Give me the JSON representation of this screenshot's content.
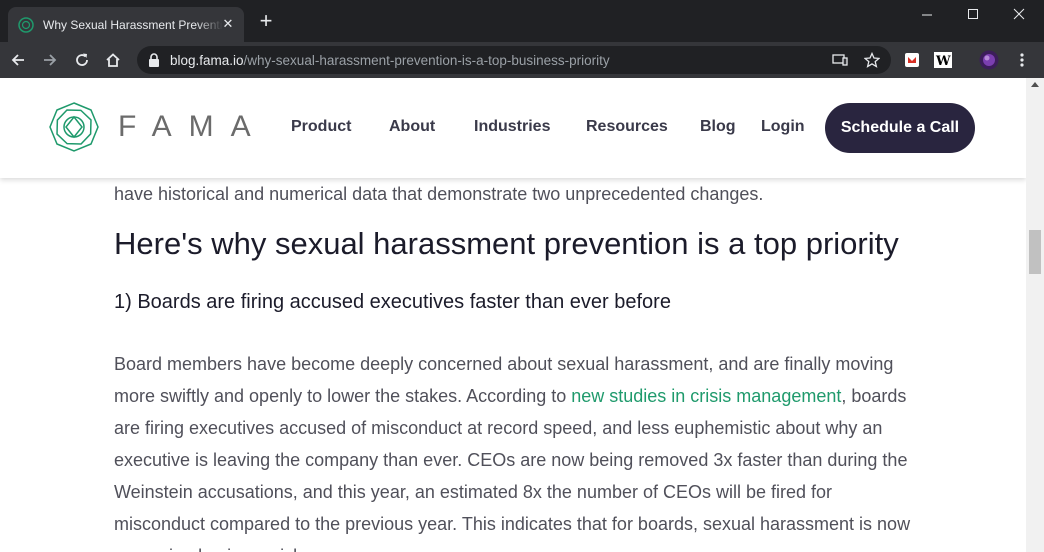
{
  "browser": {
    "tab_title": "Why Sexual Harassment Preventi",
    "tab_close": "✕",
    "new_tab": "+",
    "url_host": "blog.fama.io",
    "url_path": "/why-sexual-harassment-prevention-is-a-top-business-priority"
  },
  "site": {
    "logo_text": "FAMA",
    "nav": {
      "product": "Product",
      "about": "About",
      "industries": "Industries",
      "resources": "Resources",
      "blog": "Blog",
      "login": "Login"
    },
    "cta": "Schedule a Call",
    "brand_color": "#1f9a6c",
    "cta_color": "#29253f"
  },
  "article": {
    "top_line": "have historical and numerical data that demonstrate two unprecedented changes.",
    "heading": "Here's why sexual harassment prevention is a top priority",
    "subheading": "1) Boards are firing accused executives faster than ever before",
    "para_before_link": "Board members have become deeply concerned about sexual harassment, and are finally moving more swiftly and openly to lower the stakes. According to ",
    "link_text": "new studies in crisis management",
    "para_after_link": ", boards are firing executives accused of misconduct at record speed, and less euphemistic about why an executive is leaving the company than ever. CEOs are now being removed 3x faster than during the Weinstein accusations, and this year, an estimated 8x the number of CEOs will be fired for misconduct compared to the previous year. This indicates that for boards, sexual harassment is now a genuine business risk."
  }
}
